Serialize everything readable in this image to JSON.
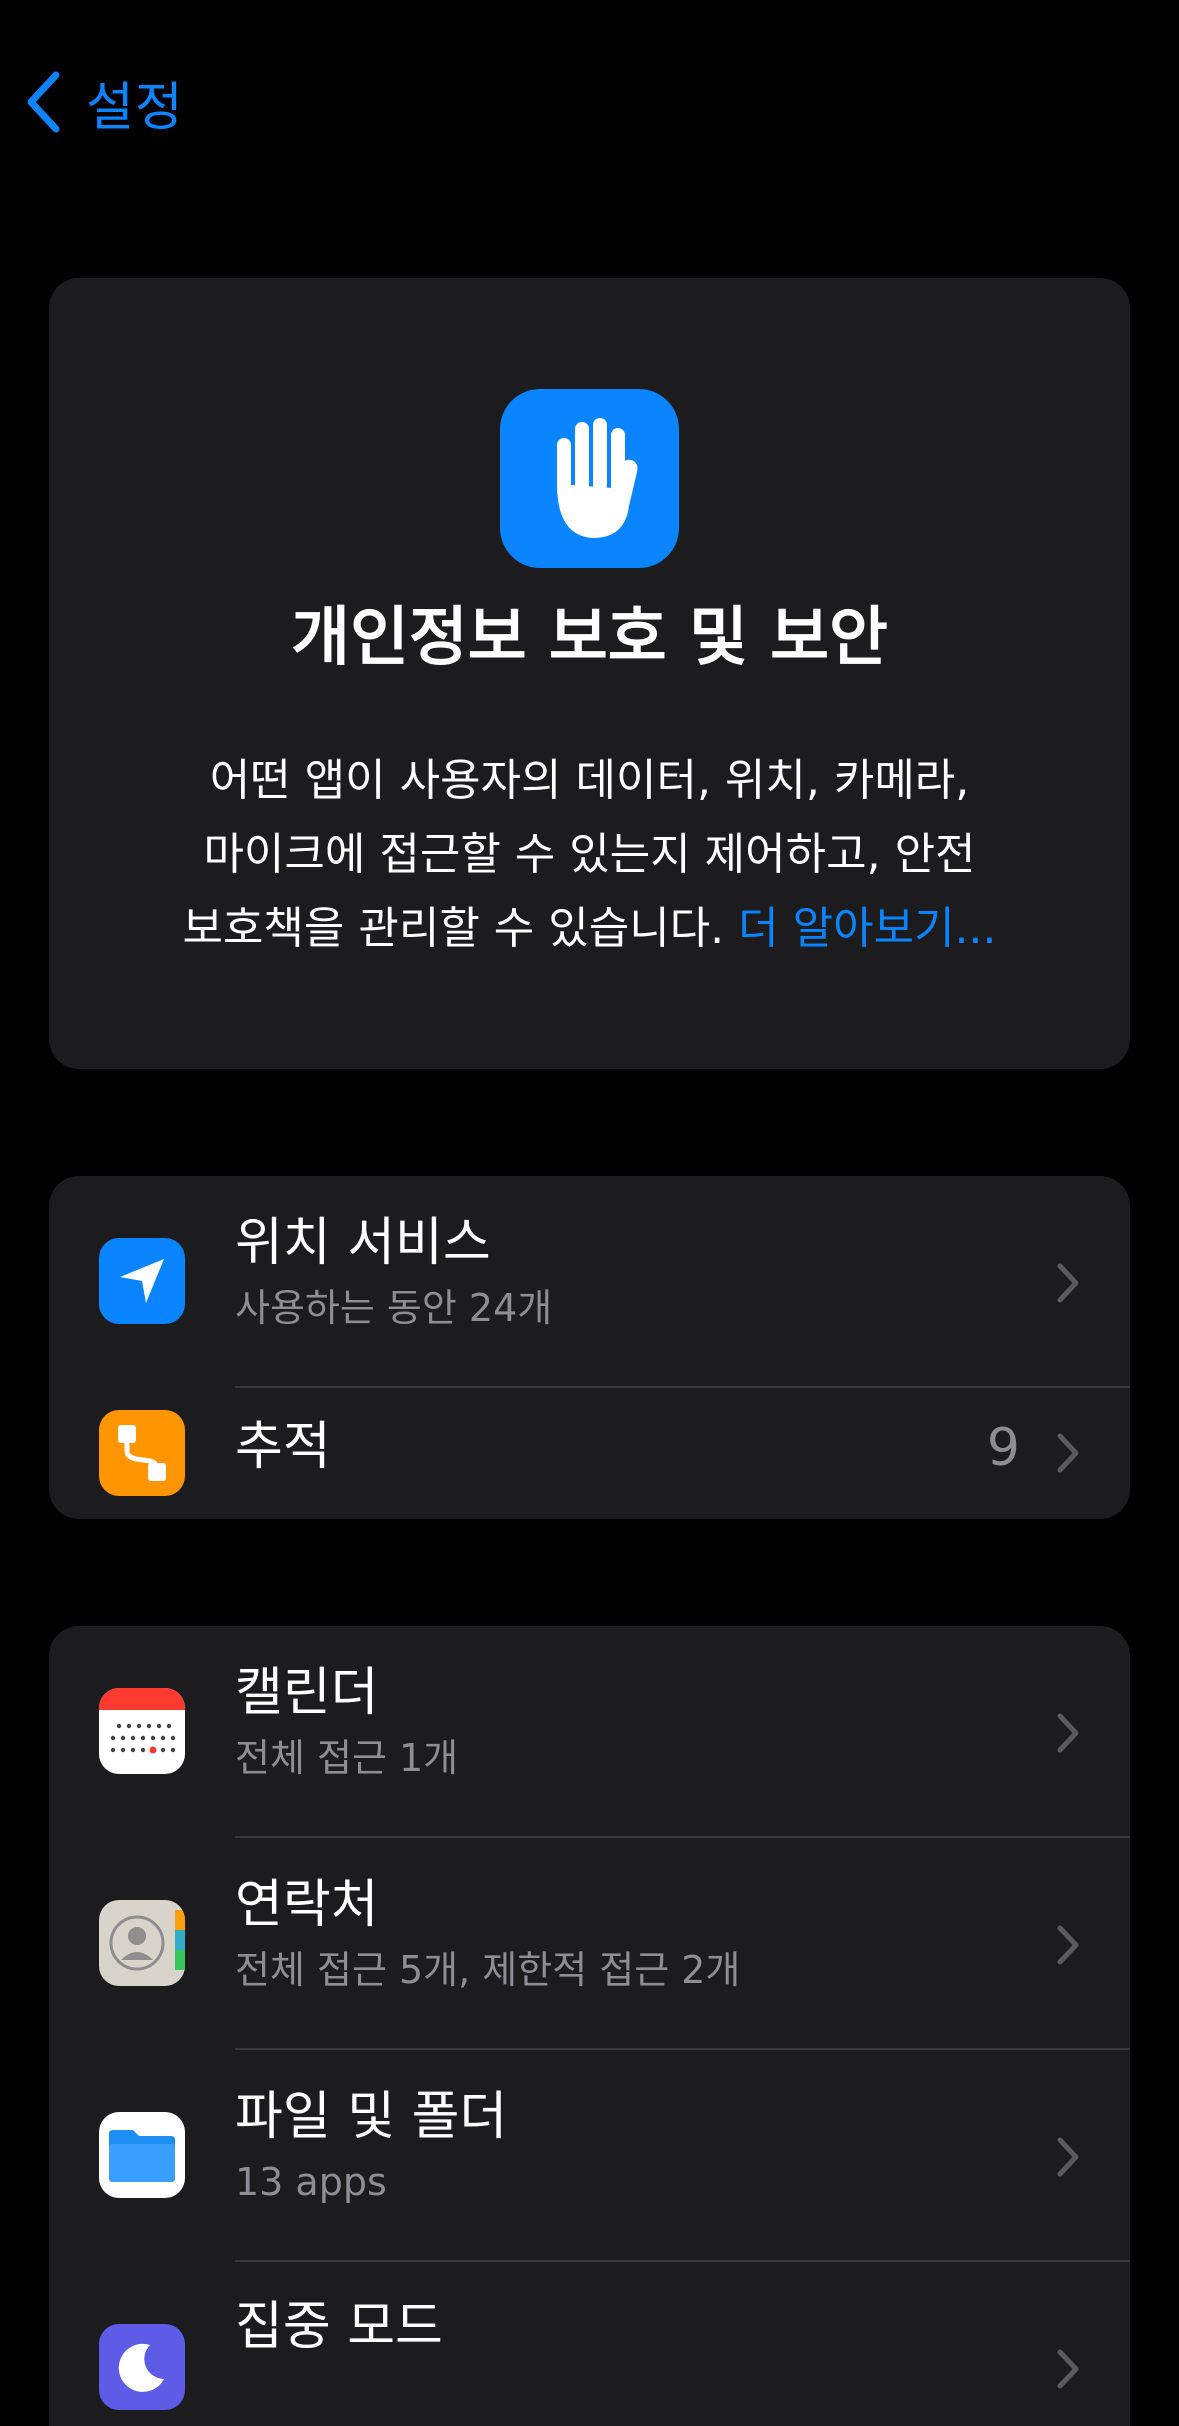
{
  "nav": {
    "back_label": "설정"
  },
  "hero": {
    "icon": "hand-raised-icon",
    "title": "개인정보 보호 및 보안",
    "desc_line1": "어떤 앱이 사용자의 데이터, 위치, 카메라,",
    "desc_line2": "마이크에 접근할 수 있는지 제어하고, 안전",
    "desc_line3": "보호책을 관리할 수 있습니다.",
    "learn_more": "더 알아보기..."
  },
  "section1": {
    "items": [
      {
        "title": "위치 서비스",
        "subtitle": "사용하는 동안 24개",
        "icon": "location-arrow-icon",
        "icon_color": "#0a84ff"
      },
      {
        "title": "추적",
        "value": "9",
        "icon": "tracking-icon",
        "icon_color": "#ff9500"
      }
    ]
  },
  "section2": {
    "items": [
      {
        "title": "캘린더",
        "subtitle": "전체 접근 1개",
        "icon": "calendar-icon"
      },
      {
        "title": "연락처",
        "subtitle": "전체 접근 5개, 제한적 접근 2개",
        "icon": "contacts-icon"
      },
      {
        "title": "파일 및 폴더",
        "subtitle": "13 apps",
        "icon": "files-folder-icon"
      },
      {
        "title": "집중 모드",
        "icon": "moon-icon",
        "icon_color": "#5e5ce6"
      }
    ]
  },
  "colors": {
    "accent": "#0a84ff",
    "background": "#000000",
    "card": "#1c1c1e",
    "secondary_text": "#8d8d93",
    "separator": "#38383a"
  }
}
